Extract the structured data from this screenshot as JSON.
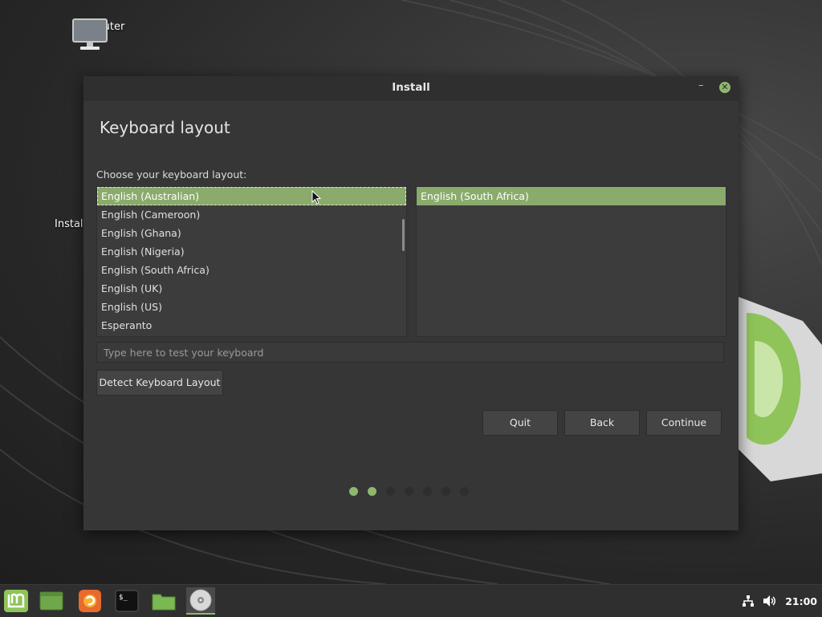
{
  "desktop": {
    "icons": [
      {
        "label": "Computer",
        "icon": "computer-icon"
      },
      {
        "label": "Instal",
        "icon": "install-disc-icon"
      }
    ]
  },
  "window": {
    "title": "Install",
    "minimize_glyph": "–",
    "close_glyph": "✕",
    "page_title": "Keyboard layout",
    "prompt": "Choose your keyboard layout:",
    "layouts": [
      "English (Australian)",
      "English (Cameroon)",
      "English (Ghana)",
      "English (Nigeria)",
      "English (South Africa)",
      "English (UK)",
      "English (US)",
      "Esperanto"
    ],
    "selected_layout": "English (Australian)",
    "variants": [
      "English (South Africa)"
    ],
    "selected_variant": "English (South Africa)",
    "test_placeholder": "Type here to test your keyboard",
    "test_value": "",
    "detect_button": "Detect Keyboard Layout",
    "quit_button": "Quit",
    "back_button": "Back",
    "continue_button": "Continue",
    "progress": {
      "total_steps": 7,
      "completed_steps": 2
    }
  },
  "taskbar": {
    "items": [
      {
        "name": "mint-menu-icon"
      },
      {
        "name": "show-desktop-icon"
      },
      {
        "name": "firefox-icon"
      },
      {
        "name": "terminal-icon"
      },
      {
        "name": "files-folder-icon"
      },
      {
        "name": "installer-disc-icon",
        "active": true
      }
    ],
    "clock": "21:00"
  },
  "colors": {
    "accent": "#8fb86e",
    "selection": "#8aab6c",
    "window_bg": "#363636"
  }
}
